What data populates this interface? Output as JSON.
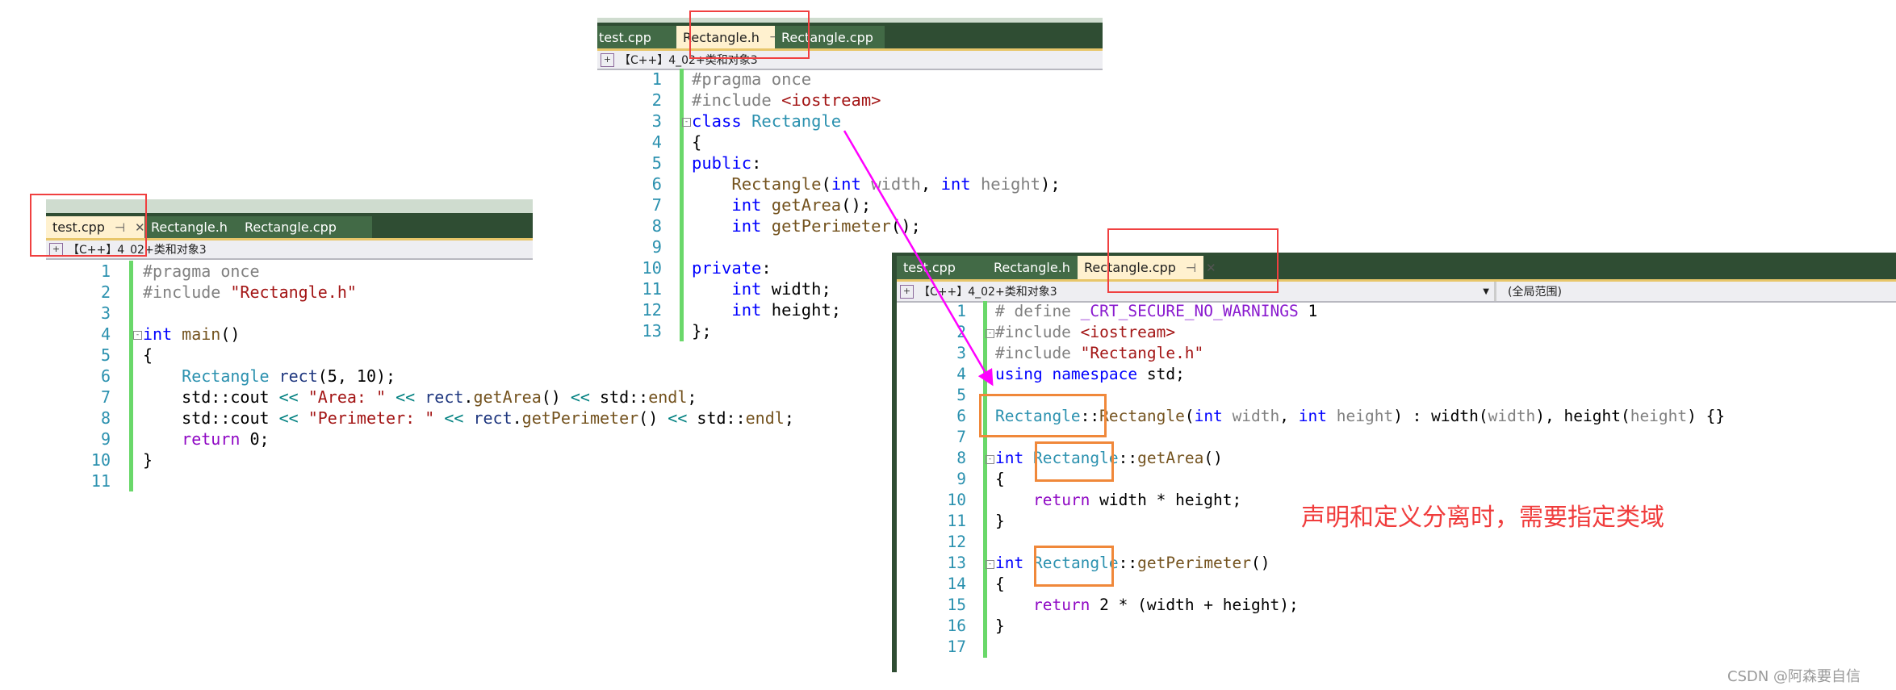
{
  "colors": {
    "tabbar": "#2f4d33",
    "active_tab": "#fff1cf",
    "annotation": "#f03c3c",
    "highlight_box": "#f0883a",
    "arrow": "#ff00ff"
  },
  "panel1": {
    "tabs": [
      "test.cpp",
      "Rectangle.h",
      "Rectangle.cpp"
    ],
    "toolbar": "【C++】4_02+类和对象3",
    "lines": [
      [
        [
          "#pragma once",
          "pp"
        ]
      ],
      [
        [
          "#include ",
          "pp"
        ],
        [
          "\"Rectangle.h\"",
          "st"
        ]
      ],
      [],
      [
        [
          "int",
          "kw"
        ],
        [
          " "
        ],
        [
          "main",
          "fn"
        ],
        [
          "()"
        ]
      ],
      [
        [
          "{"
        ]
      ],
      [
        [
          "    "
        ],
        [
          "Rectangle",
          "ty"
        ],
        [
          " "
        ],
        [
          "rect",
          "va"
        ],
        [
          "(5, 10);"
        ]
      ],
      [
        [
          "    std::cout "
        ],
        [
          "<<",
          "op"
        ],
        [
          " "
        ],
        [
          "\"Area: \"",
          "st"
        ],
        [
          " "
        ],
        [
          "<<",
          "op"
        ],
        [
          " "
        ],
        [
          "rect",
          "va"
        ],
        [
          "."
        ],
        [
          "getArea",
          "fn"
        ],
        [
          "() "
        ],
        [
          "<<",
          "op"
        ],
        [
          " std::"
        ],
        [
          "endl",
          "fn"
        ],
        [
          ";"
        ]
      ],
      [
        [
          "    std::cout "
        ],
        [
          "<<",
          "op"
        ],
        [
          " "
        ],
        [
          "\"Perimeter: \"",
          "st"
        ],
        [
          " "
        ],
        [
          "<<",
          "op"
        ],
        [
          " "
        ],
        [
          "rect",
          "va"
        ],
        [
          "."
        ],
        [
          "getPerimeter",
          "fn"
        ],
        [
          "() "
        ],
        [
          "<<",
          "op"
        ],
        [
          " std::"
        ],
        [
          "endl",
          "fn"
        ],
        [
          ";"
        ]
      ],
      [
        [
          "    "
        ],
        [
          "return",
          "rt"
        ],
        [
          " 0;"
        ]
      ],
      [
        [
          "}"
        ]
      ],
      []
    ]
  },
  "panel2": {
    "tabs": [
      "test.cpp",
      "Rectangle.h",
      "Rectangle.cpp"
    ],
    "toolbar": "【C++】4_02+类和对象3",
    "lines": [
      [
        [
          "#pragma once",
          "pp"
        ]
      ],
      [
        [
          "#include ",
          "pp"
        ],
        [
          "<iostream>",
          "st"
        ]
      ],
      [
        [
          "class",
          "kw"
        ],
        [
          " "
        ],
        [
          "Rectangle",
          "ty"
        ]
      ],
      [
        [
          "{"
        ]
      ],
      [
        [
          "public",
          "kw"
        ],
        [
          ":"
        ]
      ],
      [
        [
          "    "
        ],
        [
          "Rectangle",
          "fn"
        ],
        [
          "("
        ],
        [
          "int",
          "kw"
        ],
        [
          " "
        ],
        [
          "width",
          "pa"
        ],
        [
          ", "
        ],
        [
          "int",
          "kw"
        ],
        [
          " "
        ],
        [
          "height",
          "pa"
        ],
        [
          ");"
        ]
      ],
      [
        [
          "    "
        ],
        [
          "int",
          "kw"
        ],
        [
          " "
        ],
        [
          "getArea",
          "fn"
        ],
        [
          "();"
        ]
      ],
      [
        [
          "    "
        ],
        [
          "int",
          "kw"
        ],
        [
          " "
        ],
        [
          "getPerimeter",
          "fn"
        ],
        [
          "();"
        ]
      ],
      [],
      [
        [
          "private",
          "kw"
        ],
        [
          ":"
        ]
      ],
      [
        [
          "    "
        ],
        [
          "int",
          "kw"
        ],
        [
          " width;"
        ]
      ],
      [
        [
          "    "
        ],
        [
          "int",
          "kw"
        ],
        [
          " height;"
        ]
      ],
      [
        [
          "};"
        ]
      ]
    ]
  },
  "panel3": {
    "tabs": [
      "test.cpp",
      "Rectangle.h",
      "Rectangle.cpp"
    ],
    "toolbar": "【C++】4_02+类和对象3",
    "scope": "(全局范围)",
    "lines": [
      [
        [
          "# define ",
          "pp"
        ],
        [
          "_CRT_SECURE_NO_WARNINGS",
          "mc"
        ],
        [
          " 1"
        ]
      ],
      [
        [
          "#include ",
          "pp"
        ],
        [
          "<iostream>",
          "st"
        ]
      ],
      [
        [
          "#include ",
          "pp"
        ],
        [
          "\"Rectangle.h\"",
          "st"
        ]
      ],
      [
        [
          "using",
          "kw"
        ],
        [
          " "
        ],
        [
          "namespace",
          "kw"
        ],
        [
          " std;"
        ]
      ],
      [],
      [
        [
          "Rectangle",
          "ty"
        ],
        [
          "::"
        ],
        [
          "Rectangle",
          "fn"
        ],
        [
          "("
        ],
        [
          "int",
          "kw"
        ],
        [
          " "
        ],
        [
          "width",
          "pa"
        ],
        [
          ", "
        ],
        [
          "int",
          "kw"
        ],
        [
          " "
        ],
        [
          "height",
          "pa"
        ],
        [
          ") : width("
        ],
        [
          "width",
          "pa"
        ],
        [
          "), height("
        ],
        [
          "height",
          "pa"
        ],
        [
          ") {}"
        ]
      ],
      [],
      [
        [
          "int",
          "kw"
        ],
        [
          " "
        ],
        [
          "Rectangle",
          "ty"
        ],
        [
          "::"
        ],
        [
          "getArea",
          "fn"
        ],
        [
          "()"
        ]
      ],
      [
        [
          "{"
        ]
      ],
      [
        [
          "    "
        ],
        [
          "return",
          "rt"
        ],
        [
          " width * height;"
        ]
      ],
      [
        [
          "}"
        ]
      ],
      [],
      [
        [
          "int",
          "kw"
        ],
        [
          " "
        ],
        [
          "Rectangle",
          "ty"
        ],
        [
          "::"
        ],
        [
          "getPerimeter",
          "fn"
        ],
        [
          "()"
        ]
      ],
      [
        [
          "{"
        ]
      ],
      [
        [
          "    "
        ],
        [
          "return",
          "rt"
        ],
        [
          " 2 * (width + height);"
        ]
      ],
      [
        [
          "}"
        ]
      ],
      []
    ]
  },
  "annotation": "声明和定义分离时，需要指定类域",
  "watermark": "CSDN @阿森要自信"
}
